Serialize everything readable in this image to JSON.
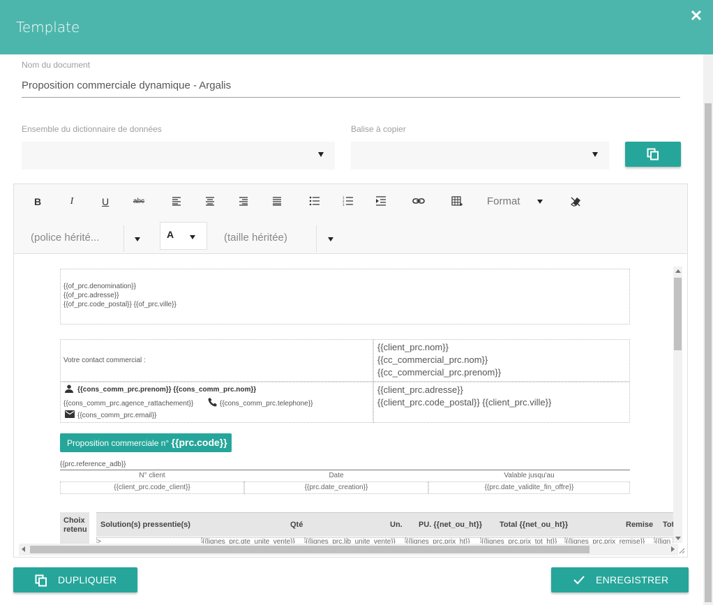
{
  "header": {
    "title": "Template",
    "close": "✕"
  },
  "document_name": {
    "label": "Nom du document",
    "value": "Proposition commerciale dynamique - Argalis"
  },
  "dictionary_select": {
    "label": "Ensemble du dictionnaire de données",
    "value": ""
  },
  "tag_select": {
    "label": "Balise à copier",
    "value": ""
  },
  "toolbar": {
    "bold": "B",
    "italic": "I",
    "underline": "U",
    "strike": "abc",
    "format": "Format",
    "font_family": "(police hérité...",
    "font_color": "A",
    "font_size": "(taille héritée)"
  },
  "content": {
    "org_lines": [
      "{{of_prc.denomination}}",
      "{{of_prc.adresse}}",
      "{{of_prc.code_postal}} {{of_prc.ville}}"
    ],
    "contact_label": "Votre contact commercial :",
    "client_name_lines": [
      "{{client_prc.nom}}",
      "{{cc_commercial_prc.nom}}",
      "{{cc_commercial_prc.prenom}}"
    ],
    "cons_name": "{{cons_comm_prc.prenom}} {{cons_comm_prc.nom}}",
    "cons_agence": "{{cons_comm_prc.agence_rattachement}}",
    "cons_tel": "{{cons_comm_prc.telephone}}",
    "cons_email": "{{cons_comm_prc.email}}",
    "client_addr_lines": [
      "{{client_prc.adresse}}",
      "{{client_prc.code_postal}} {{client_prc.ville}}"
    ],
    "banner_prefix": "Proposition commerciale n°",
    "banner_code": "{{prc.code}}",
    "reference": "{{prc.reference_adb}}",
    "info_headers": [
      "N° client",
      "Date",
      "Valable jusqu'au"
    ],
    "info_values": [
      "{{client_prc.code_client}}",
      "{{prc.date_creation}}",
      "{{prc.date_validite_fin_offre}}"
    ],
    "choix_header": "Choix retenu",
    "table_headers": [
      "Solution(s) pressentie(s)",
      "Qté",
      "Un.",
      "PU. {{net_ou_ht}}",
      "Total {{net_ou_ht}}",
      "Remise",
      "Tot"
    ],
    "table_row": [
      ">",
      "{{lignes_prc.qte_unite_vente}}",
      "{{lignes_prc.lib_unite_vente}}",
      "{{lignes_prc.prix_ht}}",
      "{{lignes_prc.prix_tot_ht}}",
      "{{lignes_prc.prix_remise}}",
      "{{lign"
    ]
  },
  "footer": {
    "duplicate": "DUPLIQUER",
    "save": "ENREGISTRER"
  }
}
